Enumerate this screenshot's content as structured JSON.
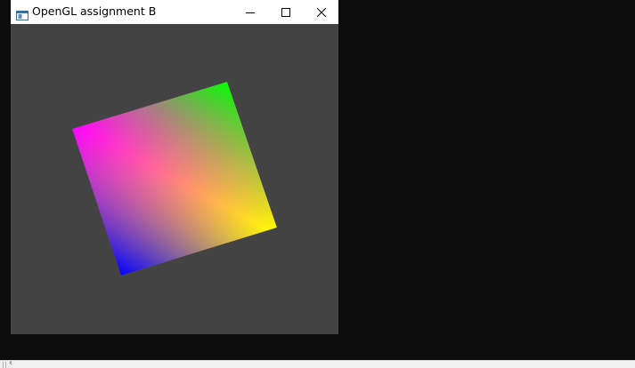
{
  "window": {
    "title": "OpenGL assignment B",
    "icon": "window-app-icon",
    "controls": {
      "minimize_icon": "minimize-icon",
      "maximize_icon": "maximize-icon",
      "close_icon": "close-icon"
    }
  },
  "scene": {
    "background_color": "#434343",
    "shape": "rotated-square",
    "vertex_colors": {
      "top_left": "#ff00ff",
      "top_right": "#00ff00",
      "bottom_right": "#ffff00",
      "bottom_left": "#0000ff"
    }
  },
  "bottom_strip": {
    "arrow": "‹"
  },
  "colors": {
    "desktop": "#0c0c0c",
    "titlebar": "#ffffff"
  }
}
